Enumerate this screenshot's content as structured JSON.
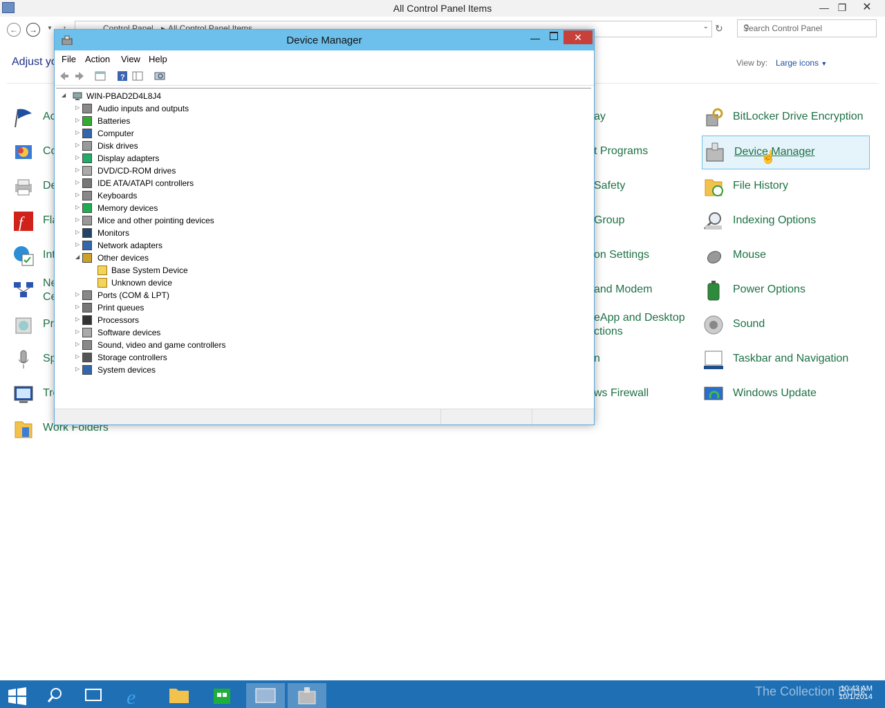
{
  "control_panel": {
    "title": "All Control Panel Items",
    "breadcrumb": [
      "Control Panel",
      "All Control Panel Items"
    ],
    "search_placeholder": "Search Control Panel",
    "adjust_heading": "Adjust yo",
    "view_by_label": "View by:",
    "view_by_value": "Large icons",
    "items_left": [
      {
        "label": "Ac"
      },
      {
        "label": "Co"
      },
      {
        "label": "De"
      },
      {
        "label": "Fla"
      },
      {
        "label": "Int"
      },
      {
        "label": "Ne\nCe"
      },
      {
        "label": "Pr"
      },
      {
        "label": "Sp"
      },
      {
        "label": "Tro"
      },
      {
        "label": "Work Folders"
      }
    ],
    "items_middle": [
      {
        "label": "ay"
      },
      {
        "label": "t Programs"
      },
      {
        "label": "Safety"
      },
      {
        "label": "Group"
      },
      {
        "label": "on Settings"
      },
      {
        "label": "and Modem"
      },
      {
        "label": "eApp and Desktop\nctions"
      },
      {
        "label": "n"
      },
      {
        "label": "ws Firewall"
      }
    ],
    "items_right": [
      {
        "label": "BitLocker Drive Encryption"
      },
      {
        "label": "Device Manager"
      },
      {
        "label": "File History"
      },
      {
        "label": "Indexing Options"
      },
      {
        "label": "Mouse"
      },
      {
        "label": "Power Options"
      },
      {
        "label": "Sound"
      },
      {
        "label": "Taskbar and Navigation"
      },
      {
        "label": "Windows Update"
      }
    ]
  },
  "device_manager": {
    "title": "Device Manager",
    "menu": [
      "File",
      "Action",
      "View",
      "Help"
    ],
    "root": "WIN-PBAD2D4L8J4",
    "categories": [
      {
        "label": "Audio inputs and outputs",
        "icon": "speaker-icon"
      },
      {
        "label": "Batteries",
        "icon": "battery-icon"
      },
      {
        "label": "Computer",
        "icon": "computer-icon"
      },
      {
        "label": "Disk drives",
        "icon": "disk-icon"
      },
      {
        "label": "Display adapters",
        "icon": "display-adapter-icon"
      },
      {
        "label": "DVD/CD-ROM drives",
        "icon": "dvd-icon"
      },
      {
        "label": "IDE ATA/ATAPI controllers",
        "icon": "ide-icon"
      },
      {
        "label": "Keyboards",
        "icon": "keyboard-icon"
      },
      {
        "label": "Memory devices",
        "icon": "memory-icon"
      },
      {
        "label": "Mice and other pointing devices",
        "icon": "mouse-icon"
      },
      {
        "label": "Monitors",
        "icon": "monitor-icon"
      },
      {
        "label": "Network adapters",
        "icon": "network-icon"
      },
      {
        "label": "Other devices",
        "icon": "unknown-device-icon",
        "expanded": true
      },
      {
        "label": "Ports (COM & LPT)",
        "icon": "port-icon"
      },
      {
        "label": "Print queues",
        "icon": "printer-icon"
      },
      {
        "label": "Processors",
        "icon": "processor-icon"
      },
      {
        "label": "Software devices",
        "icon": "software-device-icon"
      },
      {
        "label": "Sound, video and game controllers",
        "icon": "sound-icon"
      },
      {
        "label": "Storage controllers",
        "icon": "storage-icon"
      },
      {
        "label": "System devices",
        "icon": "system-icon"
      }
    ],
    "other_devices_children": [
      "Base System Device",
      "Unknown device"
    ]
  },
  "taskbar": {
    "time": "10:43 AM",
    "date": "10/1/2014",
    "watermark": "The Collection Book"
  }
}
